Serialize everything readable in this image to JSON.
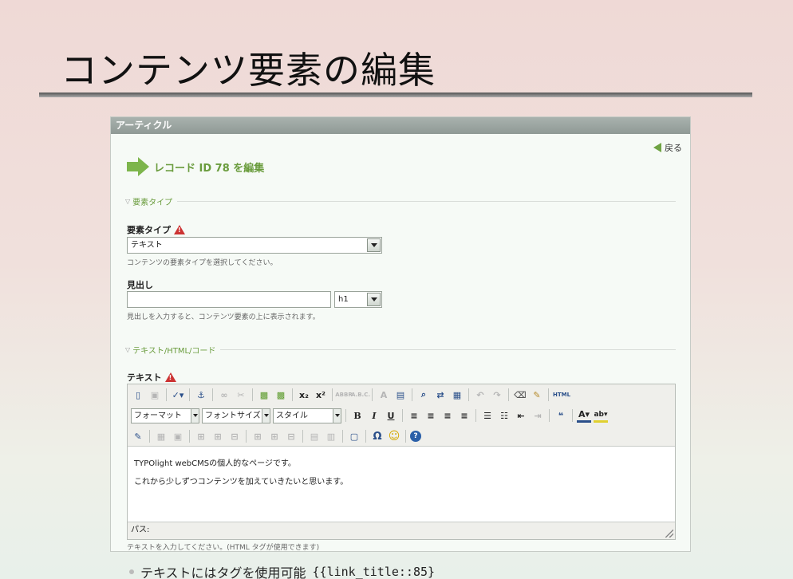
{
  "slide": {
    "title": "コンテンツ要素の編集",
    "bullet_text": "テキストにはタグを使用可能",
    "bullet_code": "{{link_title::85}"
  },
  "panel": {
    "header": "アーティクル",
    "back_label": "戻る",
    "edit_heading": "レコード ID 78 を編集"
  },
  "sections": {
    "type_legend": "要素タイプ",
    "text_legend": "テキスト/HTML/コード"
  },
  "fields": {
    "type_label": "要素タイプ",
    "type_value": "テキスト",
    "type_help": "コンテンツの要素タイプを選択してください。",
    "headline_label": "見出し",
    "headline_value": "",
    "headline_level": "h1",
    "headline_help": "見出しを入力すると、コンテンツ要素の上に表示されます。",
    "text_label": "テキスト",
    "text_help": "テキストを入力してください。(HTML タグが使用できます)"
  },
  "editor": {
    "format_label": "フォーマット",
    "font_label": "フォントサイズ",
    "style_label": "スタイル",
    "html_label": "HTML",
    "paragraph1": "TYPOlight webCMSの個人的なページです。",
    "paragraph2": "これから少しずつコンテンツを加えていきたいと思います。",
    "path_label": "パス:"
  },
  "colors": {
    "accent_green": "#6a9c3d",
    "header_gray": "#9aa39f",
    "warning_red": "#cc3333"
  }
}
